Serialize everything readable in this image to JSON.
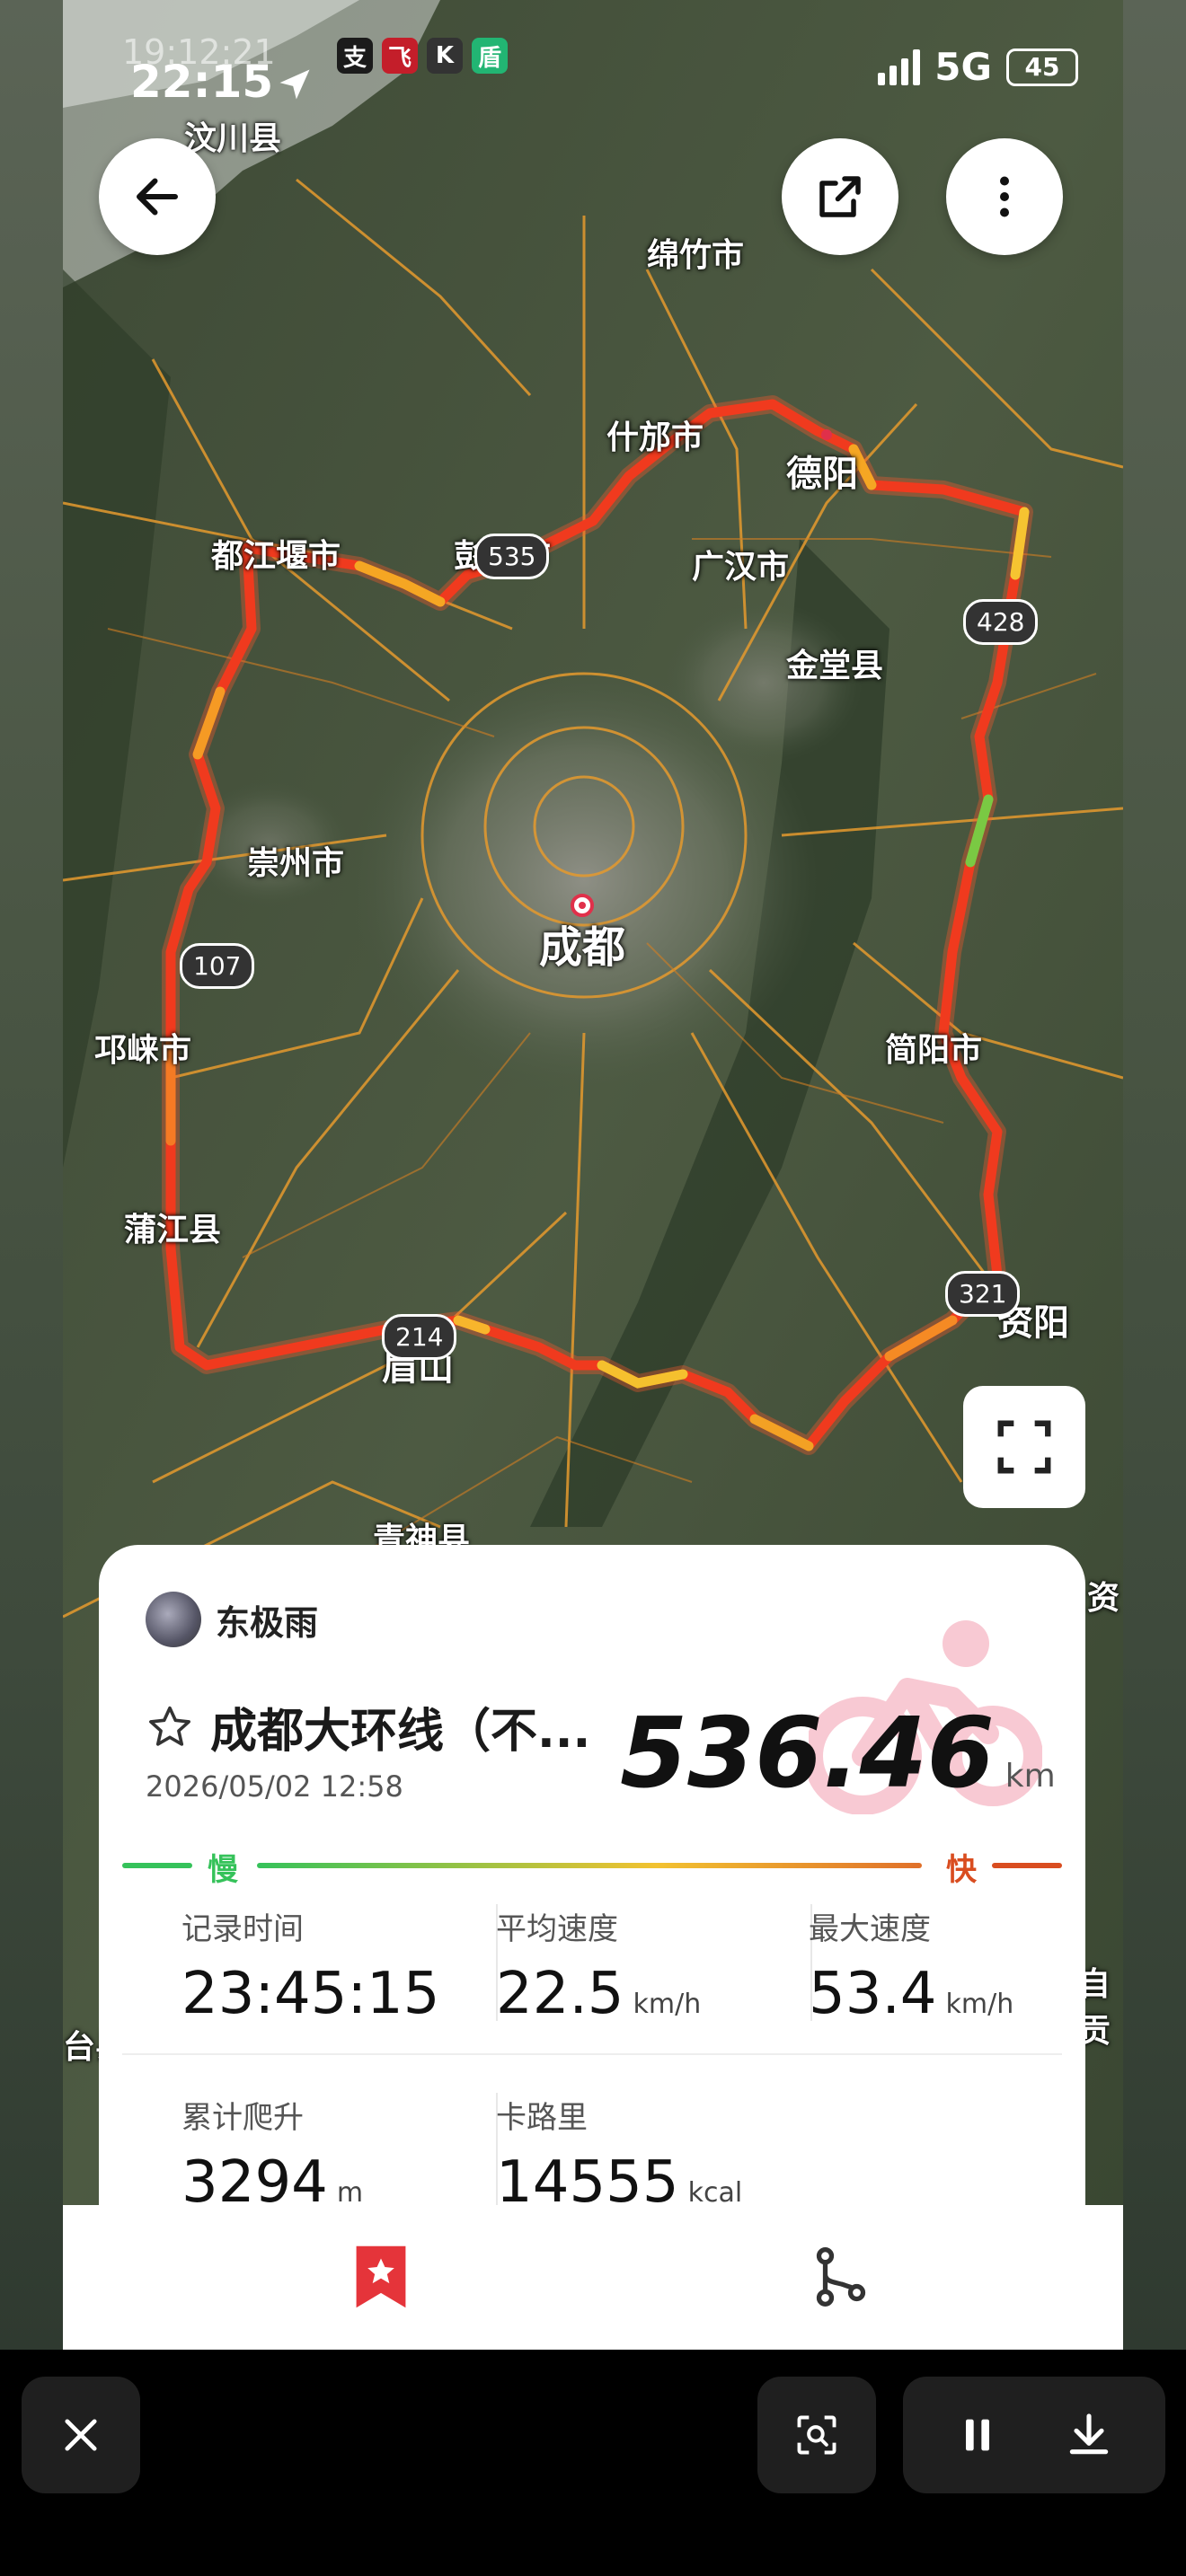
{
  "status_bar": {
    "time": "22:15",
    "ghost_time": "19:12:21",
    "network": "5G",
    "battery": "45",
    "app_icons": [
      "支",
      "飞",
      "K",
      "盾"
    ]
  },
  "map": {
    "place_labels": {
      "wenchuan": "汶川县",
      "mianzhu": "绵竹市",
      "shifang": "什邡市",
      "deyang": "德阳",
      "dujiangyan": "都江堰市",
      "pengzhou": "彭州市",
      "guanghan": "广汉市",
      "jintang": "金堂县",
      "chongzhou": "崇州市",
      "chengdu": "成都",
      "qionglai": "邛崃市",
      "jianyang": "简阳市",
      "pujiang": "蒲江县",
      "meishan": "眉山",
      "ziyang": "资阳",
      "qingshen": "青神县",
      "fragment_right": "资",
      "fragment_ziyang": "自贡",
      "fragment_left": "台县"
    },
    "road_shields": {
      "r535": "535",
      "r428": "428",
      "r107": "107",
      "r214": "214",
      "r321": "321"
    },
    "colors": {
      "slow": "#35c25a",
      "fast": "#d94d20",
      "route": "#f03a1e"
    }
  },
  "card": {
    "username": "东极雨",
    "title": "成都大环线（不...",
    "date": "2026/05/02 12:58",
    "distance": "536.46",
    "distance_unit": "km",
    "speed_slow_label": "慢",
    "speed_fast_label": "快",
    "stats": {
      "record_time": {
        "label": "记录时间",
        "value": "23:45:15",
        "unit": ""
      },
      "avg_speed": {
        "label": "平均速度",
        "value": "22.5",
        "unit": "km/h"
      },
      "max_speed": {
        "label": "最大速度",
        "value": "53.4",
        "unit": "km/h"
      },
      "elevation": {
        "label": "累计爬升",
        "value": "3294",
        "unit": "m"
      },
      "calories": {
        "label": "卡路里",
        "value": "14555",
        "unit": "kcal"
      }
    }
  }
}
